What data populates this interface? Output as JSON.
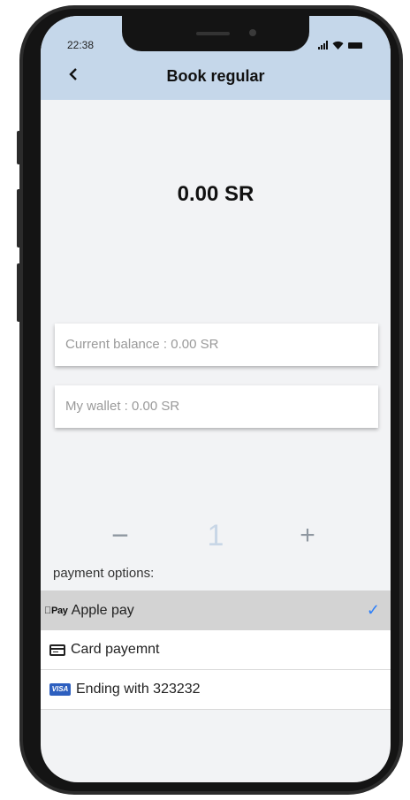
{
  "status_bar": {
    "time": "22:38"
  },
  "header": {
    "back_icon": "chevron-left-icon",
    "title": "Book regular"
  },
  "amount": "0.00 SR",
  "balances": {
    "current_balance": "Current balance : 0.00  SR",
    "wallet": "My wallet : 0.00  SR"
  },
  "quantity": {
    "minus": "−",
    "value": "1",
    "plus": "+"
  },
  "payment": {
    "label": "payment options:",
    "options": [
      {
        "icon": "apple-pay-icon",
        "icon_text": "Pay",
        "label": "Apple pay",
        "selected": true
      },
      {
        "icon": "credit-card-icon",
        "label": "Card payemnt",
        "selected": false
      },
      {
        "icon": "visa-icon",
        "icon_text": "VISA",
        "label": "Ending with 323232",
        "selected": false
      }
    ],
    "check_mark": "✓"
  },
  "colors": {
    "header_bg": "#c5d7ea",
    "screen_bg": "#f2f3f5",
    "selected_row": "#d3d3d3",
    "check": "#2d7ff9",
    "visa_blue": "#2d5fbf"
  }
}
